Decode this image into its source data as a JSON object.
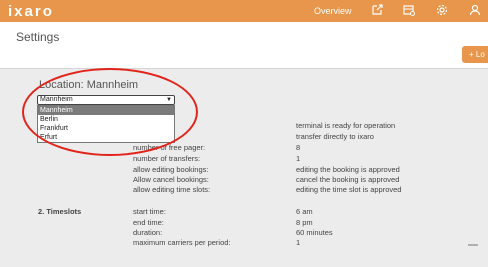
{
  "app": {
    "logo": "ixaro",
    "nav_overview": "Overview",
    "icons": [
      "external-link-icon",
      "calendar-settings-icon",
      "gear-icon",
      "user-icon"
    ],
    "accent_color": "#e8964b"
  },
  "page": {
    "title": "Settings",
    "add_button_label": "+ Lo"
  },
  "location": {
    "title": "Location: Mannheim",
    "selected": "Mannheim",
    "options": [
      "Mannheim",
      "Berlin",
      "Frankfurt",
      "Erfurt"
    ]
  },
  "general_rows": [
    {
      "label": "",
      "value": "terminal is ready for operation"
    },
    {
      "label": "",
      "value": "transfer directly to ixaro"
    },
    {
      "label": "number of free pager:",
      "value": "8"
    },
    {
      "label": "number of transfers:",
      "value": "1"
    },
    {
      "label": "allow editing bookings:",
      "value": "editing the booking is approved"
    },
    {
      "label": "Allow cancel bookings:",
      "value": "cancel the booking is approved"
    },
    {
      "label": "allow editing time slots:",
      "value": "editing the time slot is approved"
    }
  ],
  "timeslots": {
    "section_title": "2. Timeslots",
    "rows": [
      {
        "label": "start time:",
        "value": "6 am"
      },
      {
        "label": "end time:",
        "value": "8 pm"
      },
      {
        "label": "duration:",
        "value": "60 minutes"
      },
      {
        "label": "maximum carriers per period:",
        "value": "1"
      }
    ]
  }
}
